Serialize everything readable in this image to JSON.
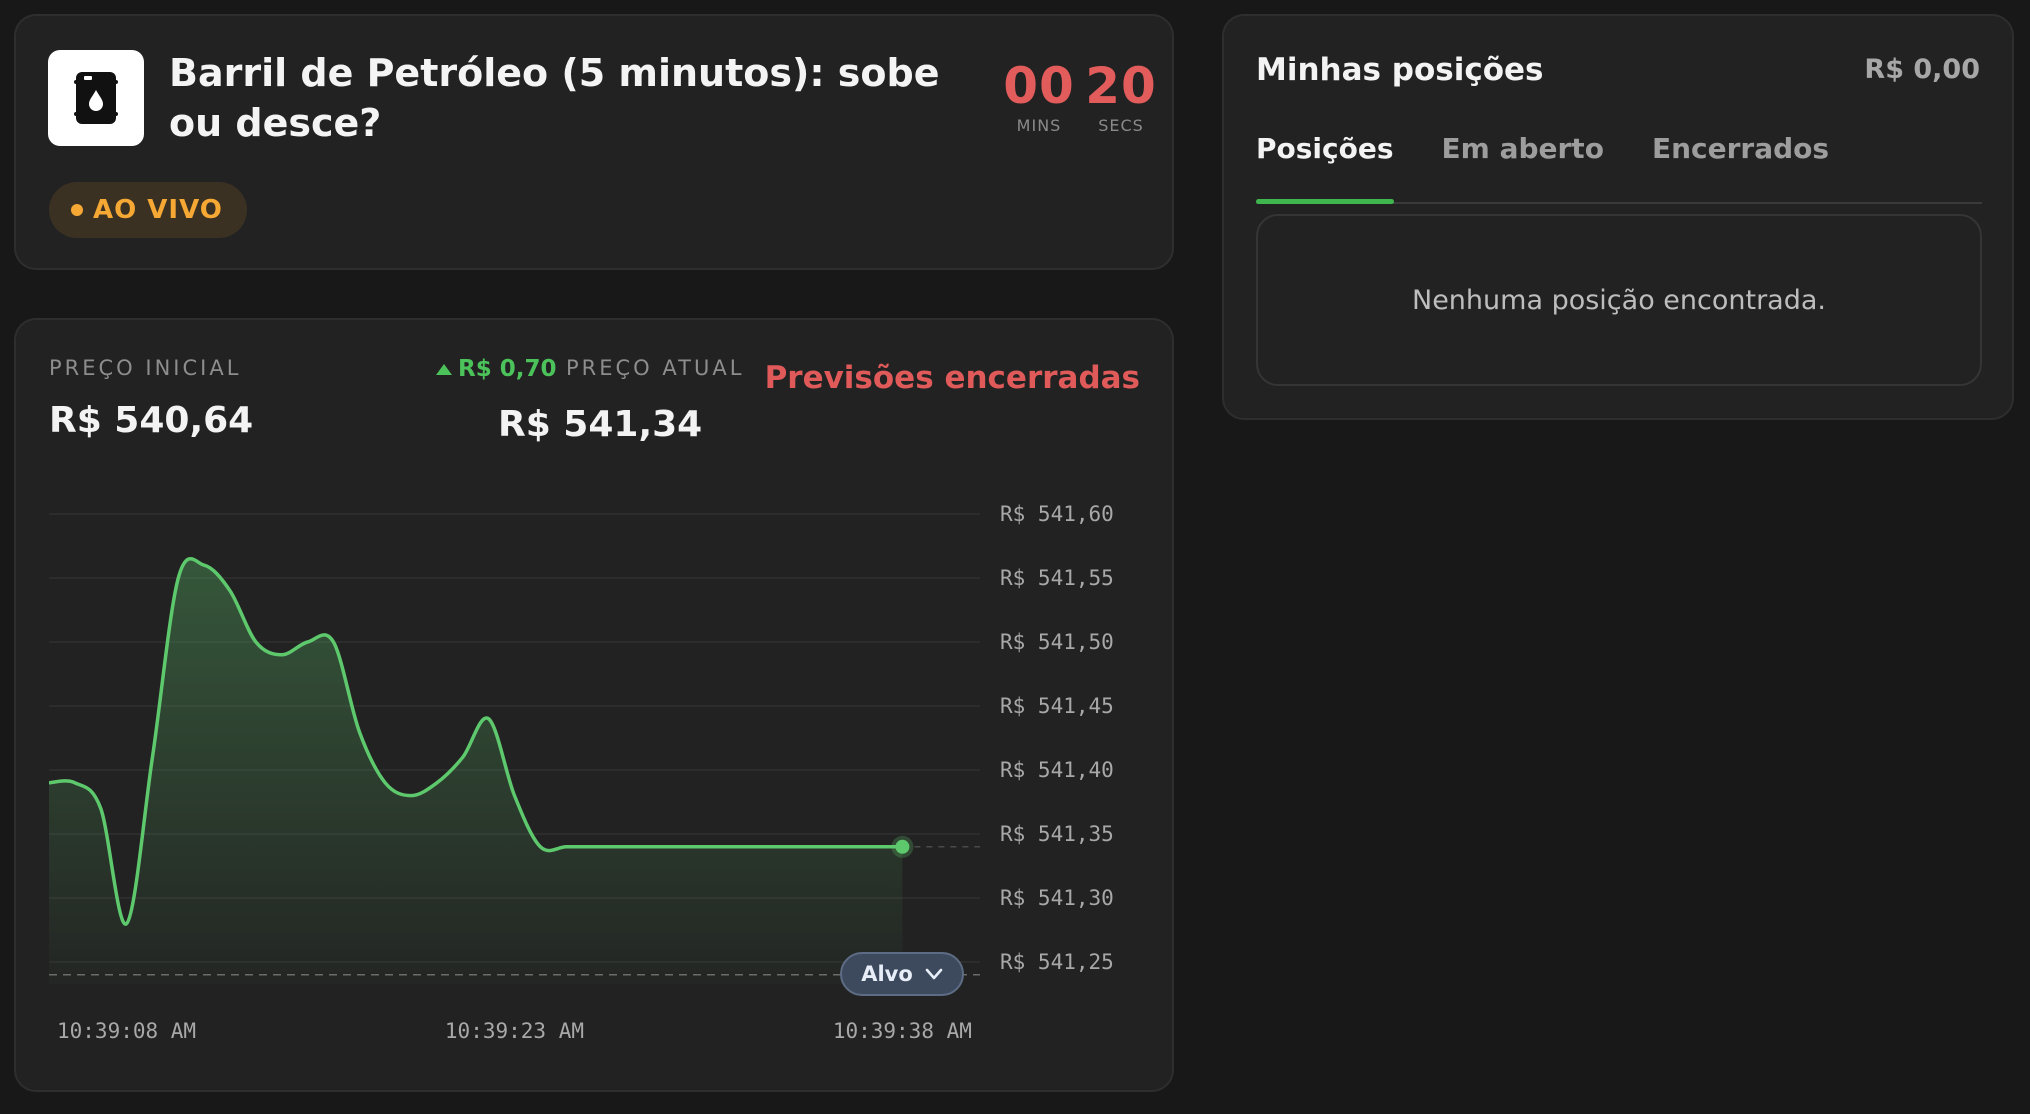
{
  "market": {
    "icon": "oil-barrel-icon",
    "title": "Barril de Petróleo (5 minutos): sobe ou desce?",
    "status": "AO VIVO",
    "timer": {
      "mins": "00",
      "mins_label": "MINS",
      "secs": "20",
      "secs_label": "SECS"
    }
  },
  "prices": {
    "initial_label": "PREÇO INICIAL",
    "initial_value": "R$ 540,64",
    "change": "R$ 0,70",
    "change_direction": "up",
    "current_label": "PREÇO ATUAL",
    "current_value": "R$ 541,34",
    "closed_label": "Previsões encerradas"
  },
  "chart_data": {
    "type": "area",
    "y_ticks": [
      "R$ 541,60",
      "R$ 541,55",
      "R$ 541,50",
      "R$ 541,45",
      "R$ 541,40",
      "R$ 541,35",
      "R$ 541,30",
      "R$ 541,25"
    ],
    "ylim": [
      541.25,
      541.6
    ],
    "x_ticks": [
      "10:39:08 AM",
      "10:39:23 AM",
      "10:39:38 AM"
    ],
    "xlim": [
      0,
      36
    ],
    "x_tick_values": [
      0,
      15,
      30
    ],
    "series": [
      {
        "x": [
          0,
          1,
          2,
          3,
          4,
          5,
          6,
          7,
          8,
          9,
          10,
          11,
          12,
          13,
          14,
          15,
          16,
          17,
          18,
          19,
          20,
          21,
          22,
          23,
          24,
          25,
          26,
          27,
          28,
          29,
          30,
          31,
          32,
          33
        ],
        "values": [
          541.39,
          541.39,
          541.37,
          541.28,
          541.41,
          541.55,
          541.56,
          541.54,
          541.5,
          541.49,
          541.5,
          541.5,
          541.43,
          541.39,
          541.38,
          541.39,
          541.41,
          541.44,
          541.38,
          541.34,
          541.34,
          541.34,
          541.34,
          541.34,
          541.34,
          541.34,
          541.34,
          541.34,
          541.34,
          541.34,
          541.34,
          541.34,
          541.34,
          541.34
        ]
      }
    ],
    "current_value": 541.34,
    "target_value": 541.24,
    "target_label": "Alvo",
    "colors": {
      "line": "#5ec86d",
      "fill": "#5ec86d",
      "grid": "#2f2f2f"
    }
  },
  "positions": {
    "title": "Minhas posições",
    "balance": "R$ 0,00",
    "tabs": [
      {
        "label": "Posições",
        "active": true
      },
      {
        "label": "Em aberto",
        "active": false
      },
      {
        "label": "Encerrados",
        "active": false
      }
    ],
    "empty_message": "Nenhuma posição encontrada."
  }
}
